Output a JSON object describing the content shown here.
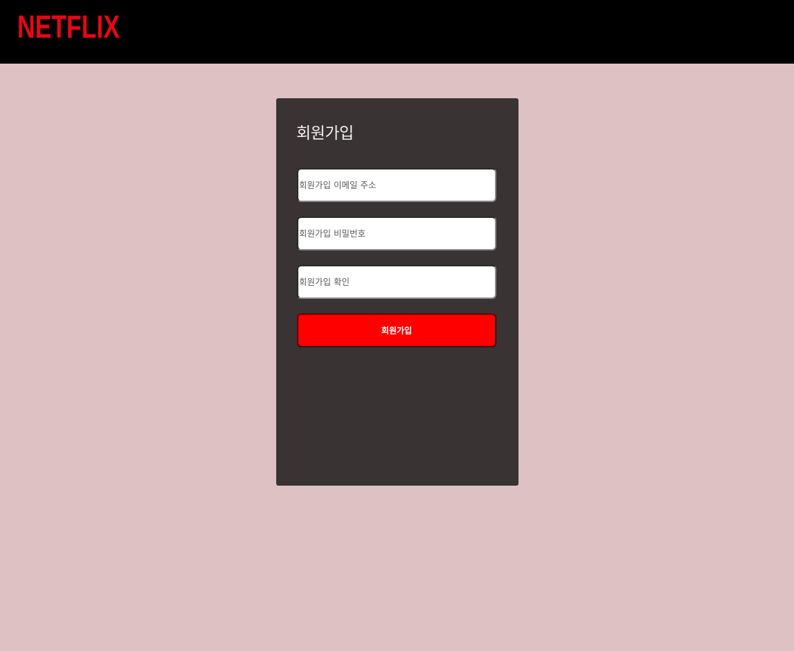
{
  "header": {
    "logo_text": "NETFLIX",
    "logo_color": "#e50914",
    "background": "#000000"
  },
  "signup": {
    "title": "회원가입",
    "email_placeholder": "회원가입 이메일 주소",
    "password_placeholder": "회원가입 비밀번호",
    "confirm_placeholder": "회원가입 확인",
    "submit_label": "회원가입",
    "submit_color": "#ff0000",
    "card_color": "#393333"
  },
  "page": {
    "background": "#dec2c3"
  }
}
